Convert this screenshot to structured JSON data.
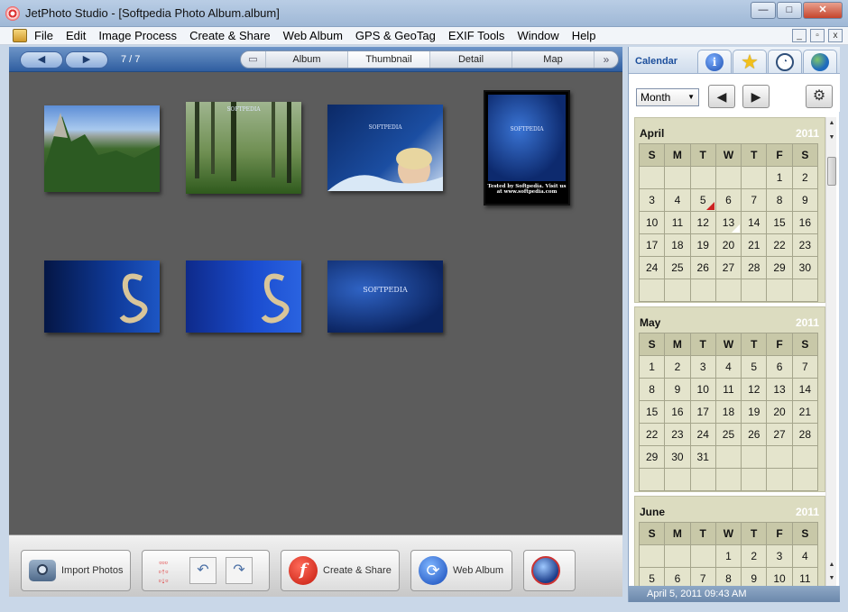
{
  "window": {
    "title": "JetPhoto Studio - [Softpedia Photo Album.album]",
    "minimize": "—",
    "maximize": "□",
    "close": "✕"
  },
  "menu": {
    "items": [
      "File",
      "Edit",
      "Image Process",
      "Create & Share",
      "Web Album",
      "GPS & GeoTag",
      "EXIF Tools",
      "Window",
      "Help"
    ],
    "mdi": [
      "_",
      "▫",
      "x"
    ]
  },
  "toolbar": {
    "prev": "◀",
    "next": "▶",
    "counter": "7 / 7",
    "tabs": [
      "Album",
      "Thumbnail",
      "Detail",
      "Map"
    ],
    "active_tab": "Thumbnail",
    "more": "»"
  },
  "thumbnails": [
    {
      "caption": ""
    },
    {
      "caption": "SOFTPEDIA"
    },
    {
      "caption": "SOFTPEDIA"
    },
    {
      "caption": "SOFTPEDIA",
      "subcaption": "Tested by Softpedia. Visit us at www.softpedia.com"
    },
    {
      "caption": ""
    },
    {
      "caption": ""
    },
    {
      "caption": "SOFTPEDIA"
    }
  ],
  "bottom_buttons": {
    "import": "Import Photos",
    "create_share": "Create & Share",
    "web_album": "Web Album"
  },
  "side_panel": {
    "tab_label": "Calendar",
    "view_select": "Month",
    "prev": "◀",
    "next": "▶",
    "gear": "⚙",
    "status": "April 5, 2011 09:43 AM"
  },
  "calendar": {
    "weekdays": [
      "S",
      "M",
      "T",
      "W",
      "T",
      "F",
      "S"
    ],
    "months": [
      {
        "name": "April",
        "year": "2011",
        "rows": [
          [
            "",
            "",
            "",
            "",
            "",
            "1",
            "2"
          ],
          [
            "3",
            "4",
            "5",
            "6",
            "7",
            "8",
            "9"
          ],
          [
            "10",
            "11",
            "12",
            "13",
            "14",
            "15",
            "16"
          ],
          [
            "17",
            "18",
            "19",
            "20",
            "21",
            "22",
            "23"
          ],
          [
            "24",
            "25",
            "26",
            "27",
            "28",
            "29",
            "30"
          ],
          [
            "",
            "",
            "",
            "",
            "",
            "",
            ""
          ]
        ]
      },
      {
        "name": "May",
        "year": "2011",
        "rows": [
          [
            "1",
            "2",
            "3",
            "4",
            "5",
            "6",
            "7"
          ],
          [
            "8",
            "9",
            "10",
            "11",
            "12",
            "13",
            "14"
          ],
          [
            "15",
            "16",
            "17",
            "18",
            "19",
            "20",
            "21"
          ],
          [
            "22",
            "23",
            "24",
            "25",
            "26",
            "27",
            "28"
          ],
          [
            "29",
            "30",
            "31",
            "",
            "",
            "",
            ""
          ],
          [
            "",
            "",
            "",
            "",
            "",
            "",
            ""
          ]
        ]
      },
      {
        "name": "June",
        "year": "2011",
        "rows": [
          [
            "",
            "",
            "",
            "1",
            "2",
            "3",
            "4"
          ],
          [
            "5",
            "6",
            "7",
            "8",
            "9",
            "10",
            "11"
          ]
        ]
      }
    ],
    "marked_red": "5",
    "marked_white": "13"
  }
}
